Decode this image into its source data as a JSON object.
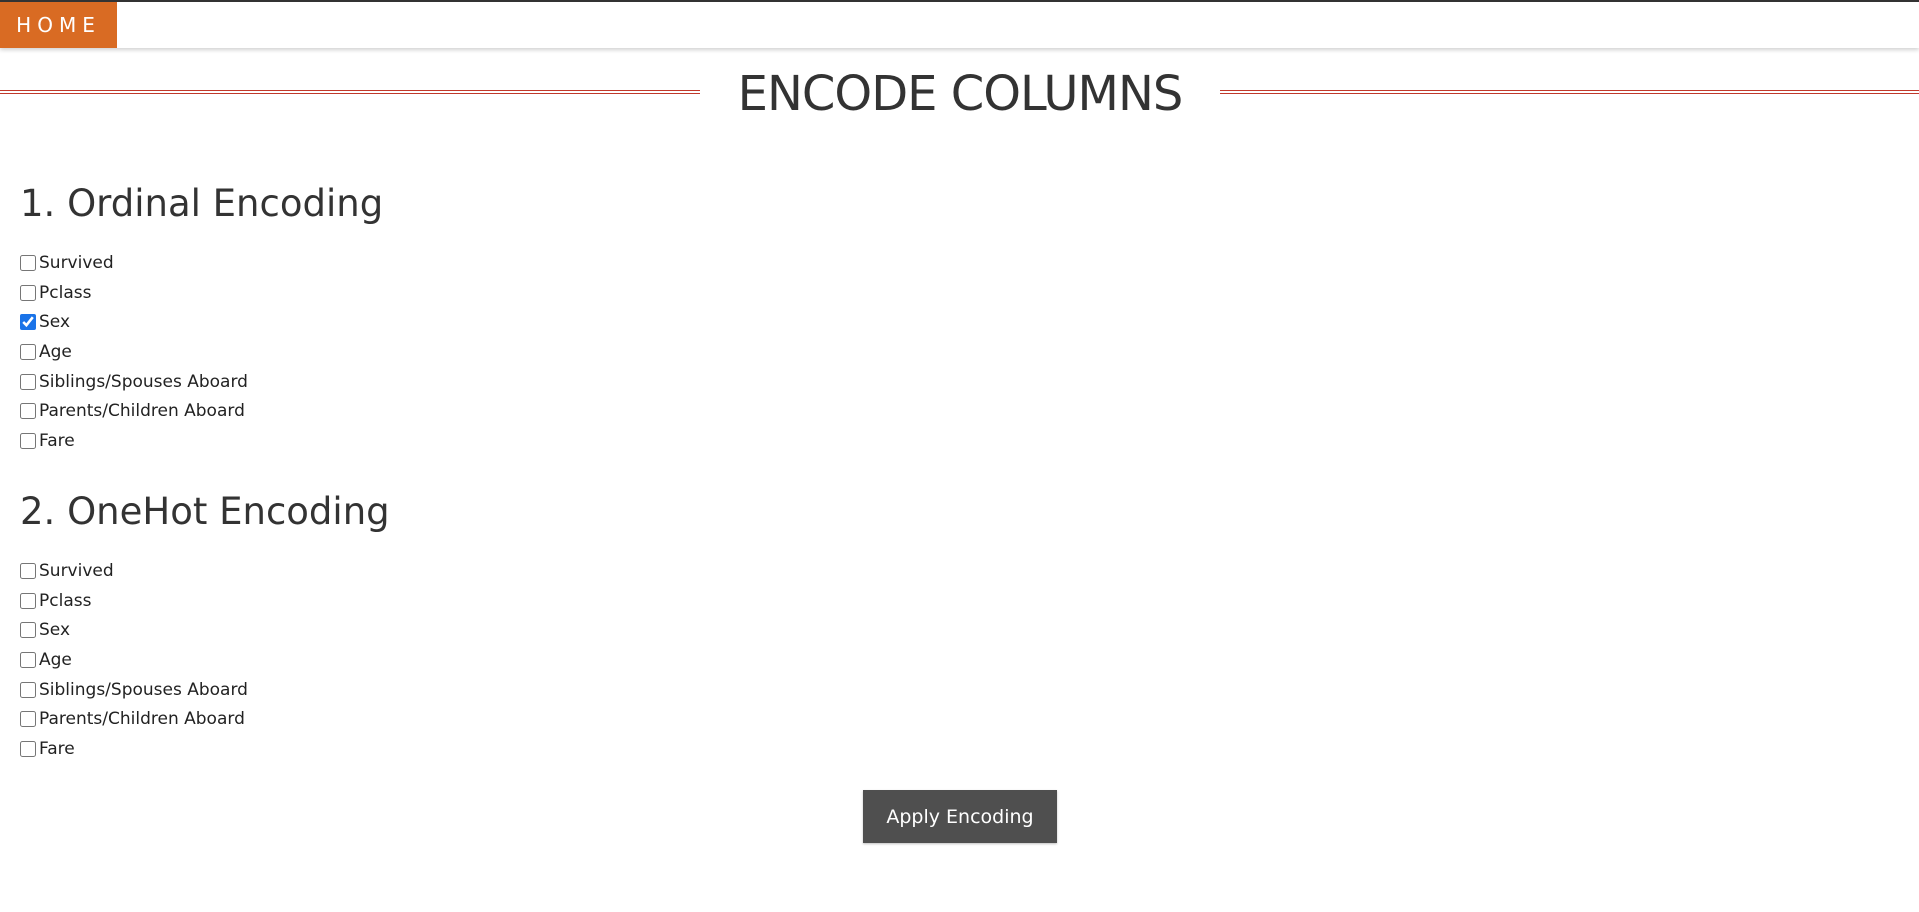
{
  "nav": {
    "home_label": "HOME"
  },
  "page": {
    "title": "ENCODE COLUMNS"
  },
  "ordinal": {
    "heading": "1. Ordinal Encoding",
    "items": [
      {
        "label": "Survived",
        "checked": false
      },
      {
        "label": "Pclass",
        "checked": false
      },
      {
        "label": "Sex",
        "checked": true
      },
      {
        "label": "Age",
        "checked": false
      },
      {
        "label": "Siblings/Spouses Aboard",
        "checked": false
      },
      {
        "label": "Parents/Children Aboard",
        "checked": false
      },
      {
        "label": "Fare",
        "checked": false
      }
    ]
  },
  "onehot": {
    "heading": "2. OneHot Encoding",
    "items": [
      {
        "label": "Survived",
        "checked": false
      },
      {
        "label": "Pclass",
        "checked": false
      },
      {
        "label": "Sex",
        "checked": false
      },
      {
        "label": "Age",
        "checked": false
      },
      {
        "label": "Siblings/Spouses Aboard",
        "checked": false
      },
      {
        "label": "Parents/Children Aboard",
        "checked": false
      },
      {
        "label": "Fare",
        "checked": false
      }
    ]
  },
  "actions": {
    "apply_label": "Apply Encoding"
  },
  "colors": {
    "home_bg": "#d96b23",
    "title_rule": "#c0392b",
    "button_bg": "#4f4f4f",
    "checkbox_accent": "#1a73e8"
  }
}
